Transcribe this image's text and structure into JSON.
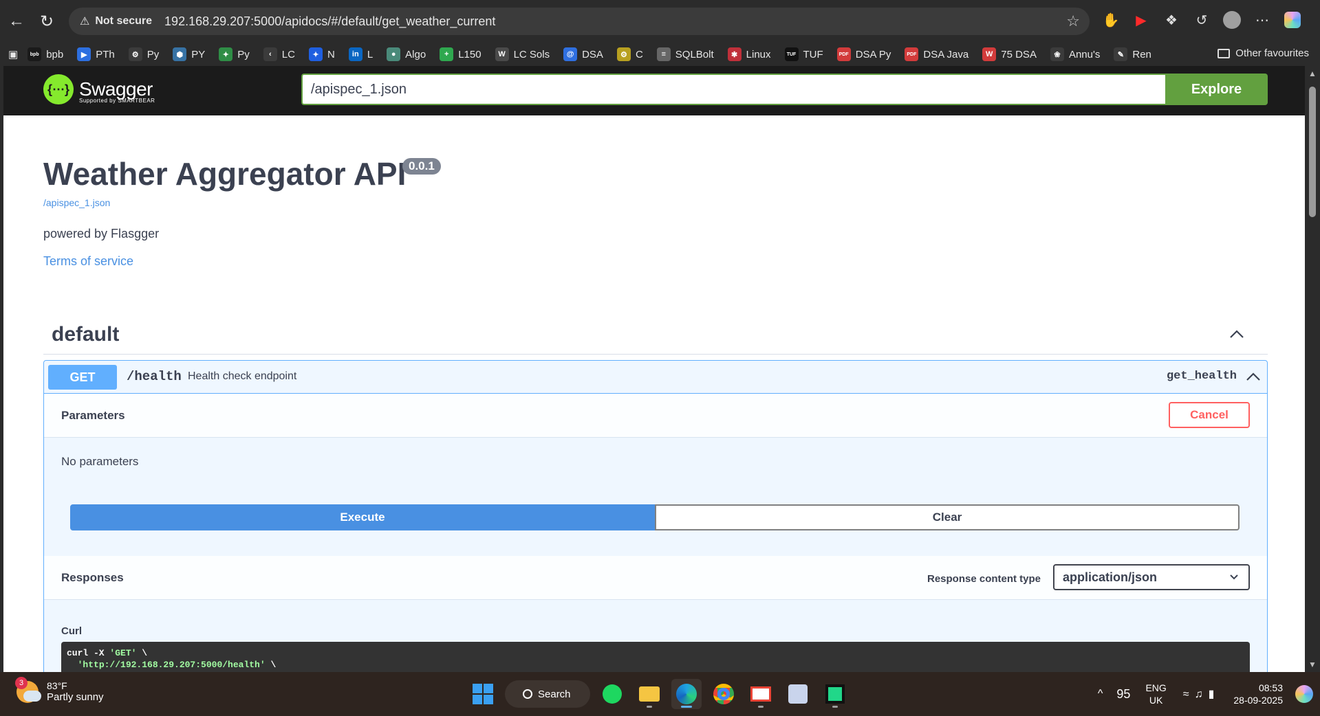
{
  "browser": {
    "security_label": "Not secure",
    "url": "192.168.29.207:5000/apidocs/#/default/get_weather_current",
    "bookmarks": [
      {
        "label": "bpb",
        "color": "#1a1a1a",
        "glyph": "bpb"
      },
      {
        "label": "PTh",
        "color": "#2d6fe0",
        "glyph": "▶"
      },
      {
        "label": "Py",
        "color": "#3b3b3b",
        "glyph": "⚙"
      },
      {
        "label": "PY",
        "color": "#3772a4",
        "glyph": "⬢"
      },
      {
        "label": "Py",
        "color": "#2f8d46",
        "glyph": "✦"
      },
      {
        "label": "LC",
        "color": "#3b3b3b",
        "glyph": "‹"
      },
      {
        "label": "N",
        "color": "#1f5fe0",
        "glyph": "✦"
      },
      {
        "label": "L",
        "color": "#0a66c2",
        "glyph": "in"
      },
      {
        "label": "Algo",
        "color": "#4a8a7a",
        "glyph": "●"
      },
      {
        "label": "L150",
        "color": "#2fa84f",
        "glyph": "+"
      },
      {
        "label": "LC Sols",
        "color": "#4a4a4a",
        "glyph": "W"
      },
      {
        "label": "DSA",
        "color": "#2f6fe0",
        "glyph": "@"
      },
      {
        "label": "C",
        "color": "#b8a020",
        "glyph": "⚙"
      },
      {
        "label": "SQLBolt",
        "color": "#666666",
        "glyph": "≡"
      },
      {
        "label": "Linux",
        "color": "#c0303a",
        "glyph": "✱"
      },
      {
        "label": "TUF",
        "color": "#111111",
        "glyph": "TUF"
      },
      {
        "label": "DSA Py",
        "color": "#d23b3b",
        "glyph": "PDF"
      },
      {
        "label": "DSA Java",
        "color": "#d23b3b",
        "glyph": "PDF"
      },
      {
        "label": "75 DSA",
        "color": "#d23b3b",
        "glyph": "W"
      },
      {
        "label": "Annu's",
        "color": "#3b3b3b",
        "glyph": "❀"
      },
      {
        "label": "Ren",
        "color": "#3b3b3b",
        "glyph": "✎"
      }
    ],
    "other_favourites": "Other favourites"
  },
  "swagger": {
    "logo_text": "Swagger",
    "logo_sub": "Supported by SMARTBEAR",
    "spec_url": "/apispec_1.json",
    "explore_label": "Explore",
    "title": "Weather Aggregator API",
    "version": "0.0.1",
    "spec_link": "/apispec_1.json",
    "description": "powered by Flasgger",
    "terms": "Terms of service",
    "tag": "default",
    "operation": {
      "method": "GET",
      "path": "/health",
      "summary": "Health check endpoint",
      "operation_id": "get_health",
      "parameters_title": "Parameters",
      "cancel_label": "Cancel",
      "no_params": "No parameters",
      "execute_label": "Execute",
      "clear_label": "Clear",
      "responses_title": "Responses",
      "response_content_type_label": "Response content type",
      "response_content_type": "application/json",
      "curl_label": "Curl",
      "curl_line1_cmd": "curl -X ",
      "curl_line1_method": "'GET'",
      "curl_line1_end": " \\",
      "curl_line2_url": "'http://192.168.29.207:5000/health'",
      "curl_line2_end": " \\"
    }
  },
  "taskbar": {
    "weather_badge": "3",
    "temperature": "83°F",
    "condition": "Partly sunny",
    "search_label": "Search",
    "tray_number": "95",
    "lang_line1": "ENG",
    "lang_line2": "UK",
    "time": "08:53",
    "date": "28-09-2025"
  }
}
